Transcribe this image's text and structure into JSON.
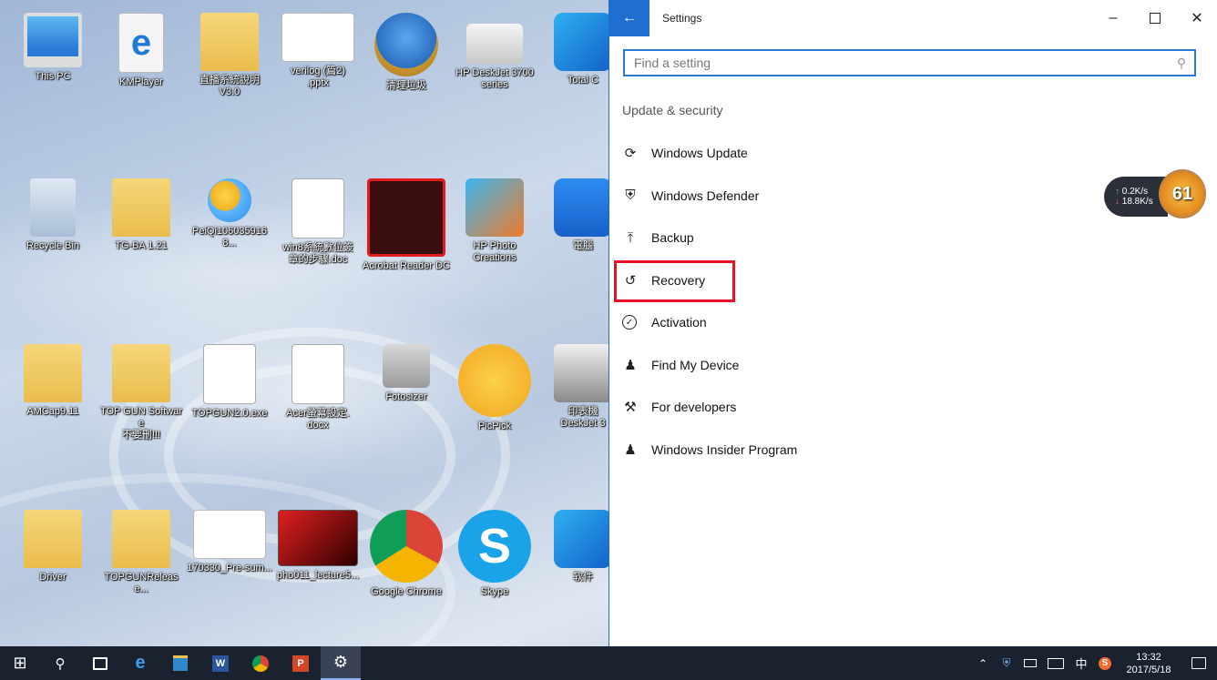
{
  "desktop": {
    "icons": [
      {
        "label": "This PC",
        "icon": "computer-icon"
      },
      {
        "label": "KMPlayer",
        "icon": "ie-file-icon"
      },
      {
        "label": "直播系統說明\nV3.0",
        "icon": "folder-icon"
      },
      {
        "label": "verilog (篇2)\n.pptx",
        "icon": "pptx-file-icon"
      },
      {
        "label": "清理垃圾",
        "icon": "broom-icon"
      },
      {
        "label": "HP DeskJet 3700\nseries",
        "icon": "printer-icon"
      },
      {
        "label": "Total C",
        "icon": "app-icon"
      },
      {
        "label": "Recycle Bin",
        "icon": "recycle-bin-icon"
      },
      {
        "label": "TG-BA 1.21",
        "icon": "folder-icon"
      },
      {
        "label": "PeiQi1060359168...",
        "icon": "chat-icon"
      },
      {
        "label": "win8系統數位簽\n章的步驟.doc",
        "icon": "word-doc-icon"
      },
      {
        "label": "Acrobat Reader DC",
        "icon": "acrobat-icon"
      },
      {
        "label": "HP Photo\nCreations",
        "icon": "photo-app-icon"
      },
      {
        "label": "電腦",
        "icon": "shield-app-icon"
      },
      {
        "label": "AMCap9.11",
        "icon": "folder-icon"
      },
      {
        "label": "TOP GUN Software\n不要刪!!!",
        "icon": "folder-icon"
      },
      {
        "label": "TOPGUN2.0.exe",
        "icon": "installer-icon"
      },
      {
        "label": "Acer螢幕設定.\ndocx",
        "icon": "word-doc-icon"
      },
      {
        "label": "Fotosizer",
        "icon": "camera-icon"
      },
      {
        "label": "PicPick",
        "icon": "palette-icon"
      },
      {
        "label": "印表機\nDeskJet 3",
        "icon": "printer-app-icon"
      },
      {
        "label": "Driver",
        "icon": "folder-icon"
      },
      {
        "label": "TOPGUNRelease...",
        "icon": "folder-icon"
      },
      {
        "label": "170330_Pre-sum...",
        "icon": "pptx-file-icon"
      },
      {
        "label": "pho011_lecture5...",
        "icon": "video-file-icon"
      },
      {
        "label": "Google Chrome",
        "icon": "chrome-icon"
      },
      {
        "label": "Skype",
        "icon": "skype-icon"
      },
      {
        "label": "软件",
        "icon": "app-icon"
      }
    ]
  },
  "settings": {
    "window_title": "Settings",
    "search_placeholder": "Find a setting",
    "section_title": "Update & security",
    "nav_items": [
      {
        "label": "Windows Update",
        "icon": "refresh-icon"
      },
      {
        "label": "Windows Defender",
        "icon": "shield-icon"
      },
      {
        "label": "Backup",
        "icon": "upload-icon"
      },
      {
        "label": "Recovery",
        "icon": "history-icon"
      },
      {
        "label": "Activation",
        "icon": "check-circle-icon"
      },
      {
        "label": "Find My Device",
        "icon": "person-pin-icon"
      },
      {
        "label": "For developers",
        "icon": "tools-icon"
      },
      {
        "label": "Windows Insider Program",
        "icon": "insider-icon"
      }
    ]
  },
  "net_widget": {
    "upload": "0.2K/s",
    "download": "18.8K/s",
    "badge": "61"
  },
  "taskbar": {
    "time": "13:32",
    "date": "2017/5/18",
    "ime_label": "中"
  },
  "colors": {
    "accent": "#1f6fd0",
    "highlight": "#e81123",
    "taskbar": "#1a2230"
  }
}
